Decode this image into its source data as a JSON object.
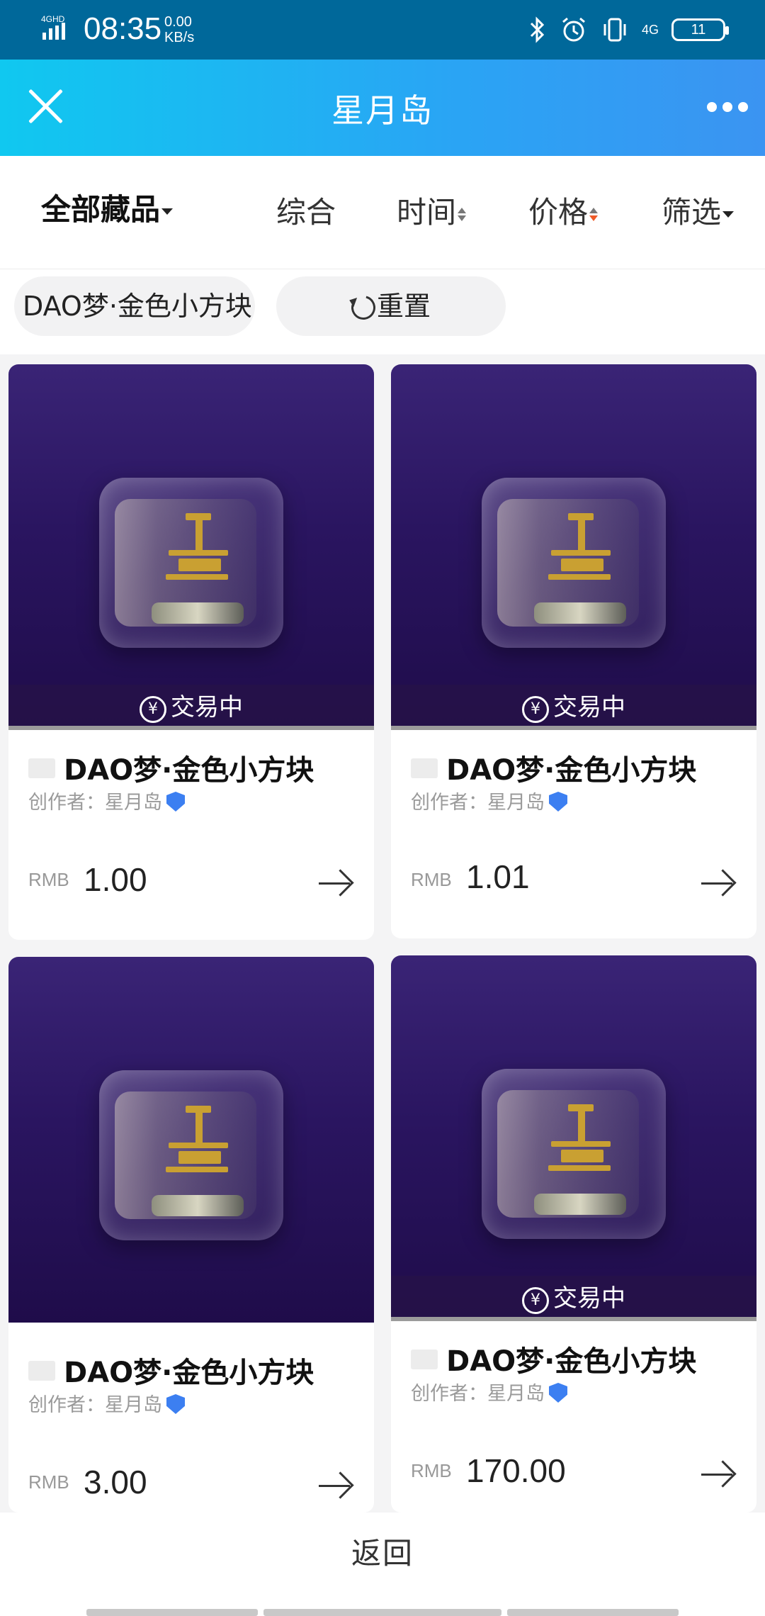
{
  "status_bar": {
    "network": "4GHD",
    "time": "08:35",
    "speed_value": "0.00",
    "speed_unit": "KB/s",
    "right_network": "4G",
    "battery": "11",
    "icons": [
      "bluetooth-icon",
      "alarm-icon",
      "vibrate-icon"
    ]
  },
  "header": {
    "title": "星月岛",
    "close_icon": "close-icon",
    "more_icon": "more-icon"
  },
  "sort_bar": {
    "all_label": "全部藏品",
    "comprehensive": "综合",
    "time": "时间",
    "price": "价格",
    "filter": "筛选"
  },
  "filters": {
    "active_tag": "DAO梦·金色小方块",
    "reset_label": "重置"
  },
  "products": [
    {
      "name": "DAO梦·金色小方块",
      "author": "创作者：星月岛",
      "currency": "RMB",
      "price": "1.00",
      "status": "交易中"
    },
    {
      "name": "DAO梦·金色小方块",
      "author": "创作者：星月岛",
      "currency": "RMB",
      "price": "1.01",
      "status": "交易中"
    },
    {
      "name": "DAO梦·金色小方块",
      "author": "创作者：星月岛",
      "currency": "RMB",
      "price": "3.00",
      "status": ""
    },
    {
      "name": "DAO梦·金色小方块",
      "author": "创作者：星月岛",
      "currency": "RMB",
      "price": "170.00",
      "status": "交易中"
    }
  ],
  "footer": {
    "back_label": "返回"
  },
  "colors": {
    "status_bar": "#00689a",
    "header_start": "#10c8f0",
    "header_end": "#3b94f2",
    "accent_red": "#f05a28",
    "verified_blue": "#3c7ff1",
    "card_purple": "#2a1560"
  }
}
